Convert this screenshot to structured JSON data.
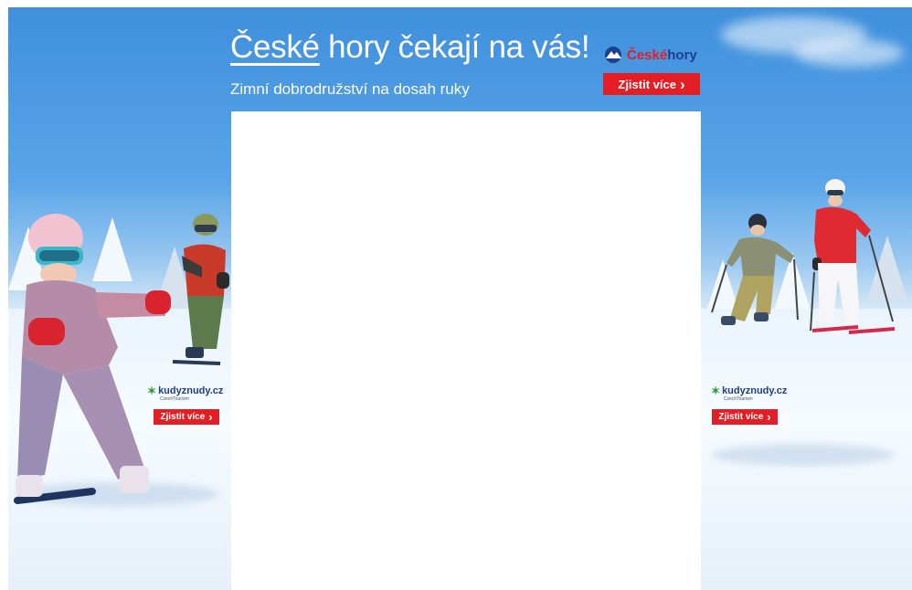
{
  "banner": {
    "headline_word1": "České",
    "headline_rest": " hory čekají na vás!",
    "subhead": "Zimní dobrodružství na dosah ruky",
    "logo_ceske": "České",
    "logo_hory": "hory",
    "cta_top": "Zjistit více",
    "cta_arrow": "›"
  },
  "left_panel": {
    "logo_text": "kudyznudy.cz",
    "logo_sub": "CzechTourism",
    "cta": "Zjistit více"
  },
  "right_panel": {
    "logo_text": "kudyznudy.cz",
    "logo_sub": "CzechTourism",
    "cta": "Zjistit více"
  },
  "colors": {
    "accent_red": "#e31e24",
    "brand_blue": "#1d3f8f",
    "sky": "#3f8fdc"
  }
}
